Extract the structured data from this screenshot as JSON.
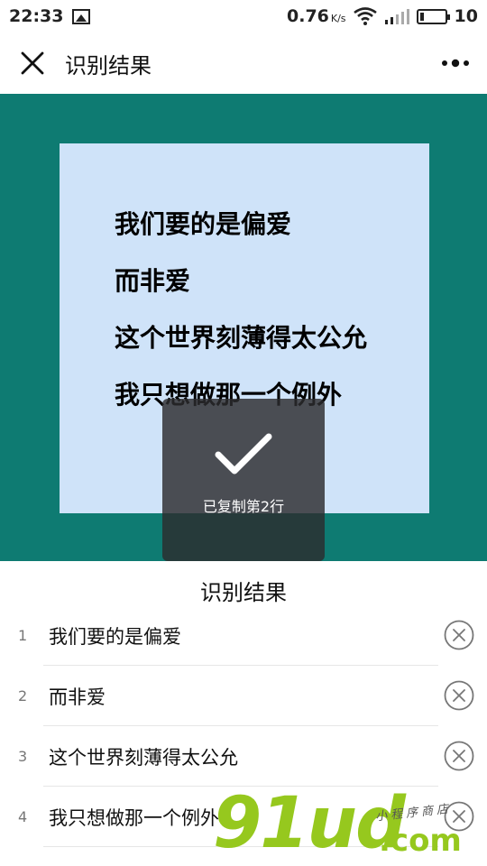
{
  "status_bar": {
    "time": "22:33",
    "speed": "0.76",
    "speed_unit": "K/s",
    "battery": "10"
  },
  "title_bar": {
    "title": "识别结果"
  },
  "preview": {
    "lines": [
      "我们要的是偏爱",
      "而非爱",
      "这个世界刻薄得太公允",
      "我只想做那一个例外"
    ]
  },
  "toast": {
    "text": "已复制第2行"
  },
  "results": {
    "heading": "识别结果",
    "items": [
      {
        "num": "1",
        "text": "我们要的是偏爱"
      },
      {
        "num": "2",
        "text": "而非爱"
      },
      {
        "num": "3",
        "text": "这个世界刻薄得太公允"
      },
      {
        "num": "4",
        "text": "我只想做那一个例外"
      }
    ]
  },
  "watermark": {
    "main": "91ud",
    "com": ".com",
    "small": "小程序商店"
  },
  "colors": {
    "preview_bg": "#0e7b72",
    "image_bg": "#cfe3f9",
    "watermark": "#96c81e"
  }
}
